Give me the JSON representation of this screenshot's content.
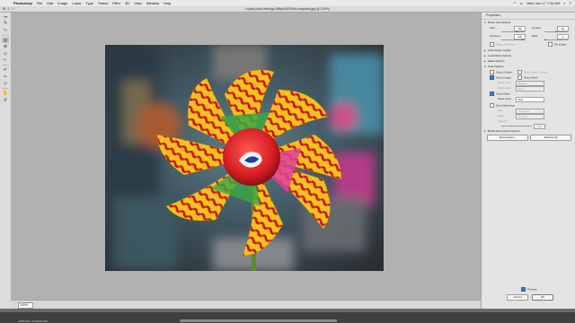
{
  "menubar": {
    "app_name": "Photoshop",
    "items": [
      "File",
      "Edit",
      "Image",
      "Layer",
      "Type",
      "Select",
      "Filter",
      "3D",
      "View",
      "Window",
      "Help"
    ],
    "clock": "Wed Jan 17  7:34 AM"
  },
  "window": {
    "title": "Liquify (stick-feelings-t0Ntp000000dx-unsplash.jpg @ 100%)"
  },
  "toolbar": {
    "tools": [
      "forward-warp-icon",
      "reconstruct-icon",
      "smooth-icon",
      "twirl-icon",
      "pucker-icon",
      "bloat-icon",
      "push-left-icon",
      "freeze-mask-icon",
      "thaw-mask-icon",
      "face-tool-icon",
      "hand-icon",
      "zoom-icon"
    ]
  },
  "status": {
    "zoom": "100%"
  },
  "panel": {
    "title": "Properties",
    "brush_tool_options": {
      "label": "Brush Tool Options",
      "size_label": "Size:",
      "size_value": "100",
      "density_label": "Density:",
      "density_value": "50",
      "pressure_label": "Pressure:",
      "pressure_value": "100",
      "rate_label": "Rate:",
      "rate_value": "0",
      "stylus_label": "Stylus Pressure",
      "pin_edges_label": "Pin Edges"
    },
    "face_aware_liquify": {
      "label": "Face-Aware Liquify"
    },
    "load_mesh_options": {
      "label": "Load Mesh Options"
    },
    "mask_options": {
      "label": "Mask Options"
    },
    "view_options": {
      "label": "View Options",
      "show_guides": "Show Guides",
      "show_face_overlay": "Show Face Overlay",
      "show_image": "Show Image",
      "show_mesh": "Show Mesh",
      "mesh_size_label": "Mesh Size:",
      "mesh_size_value": "Medium",
      "mesh_color_label": "Mesh Color:",
      "mesh_color_value": "Gray",
      "show_mask": "Show Mask",
      "mask_color_label": "Mask Color:",
      "mask_color_value": "Red",
      "show_backdrop": "Show Backdrop",
      "use_label": "Use:",
      "use_value": "All Layers",
      "mode_label": "Mode:",
      "mode_value": "In Front",
      "opacity_label": "Opacity:",
      "opacity_value": "50"
    },
    "brush_reconstruct_options": {
      "label": "Brush Reconstruct Options",
      "reconstruct_button": "Reconstruct...",
      "restore_all_button": "Restore All"
    },
    "preview_label": "Preview",
    "cancel_button": "Cancel",
    "ok_button": "OK"
  },
  "bottom": {
    "status_text": "100%     Doc: 24.9M/24.9M"
  },
  "colors": {
    "accent": "#3b79d9",
    "canvas": "#b1b1b1",
    "pinwheel_yellow": "#f2c21b",
    "pinwheel_red": "#c8141e"
  }
}
